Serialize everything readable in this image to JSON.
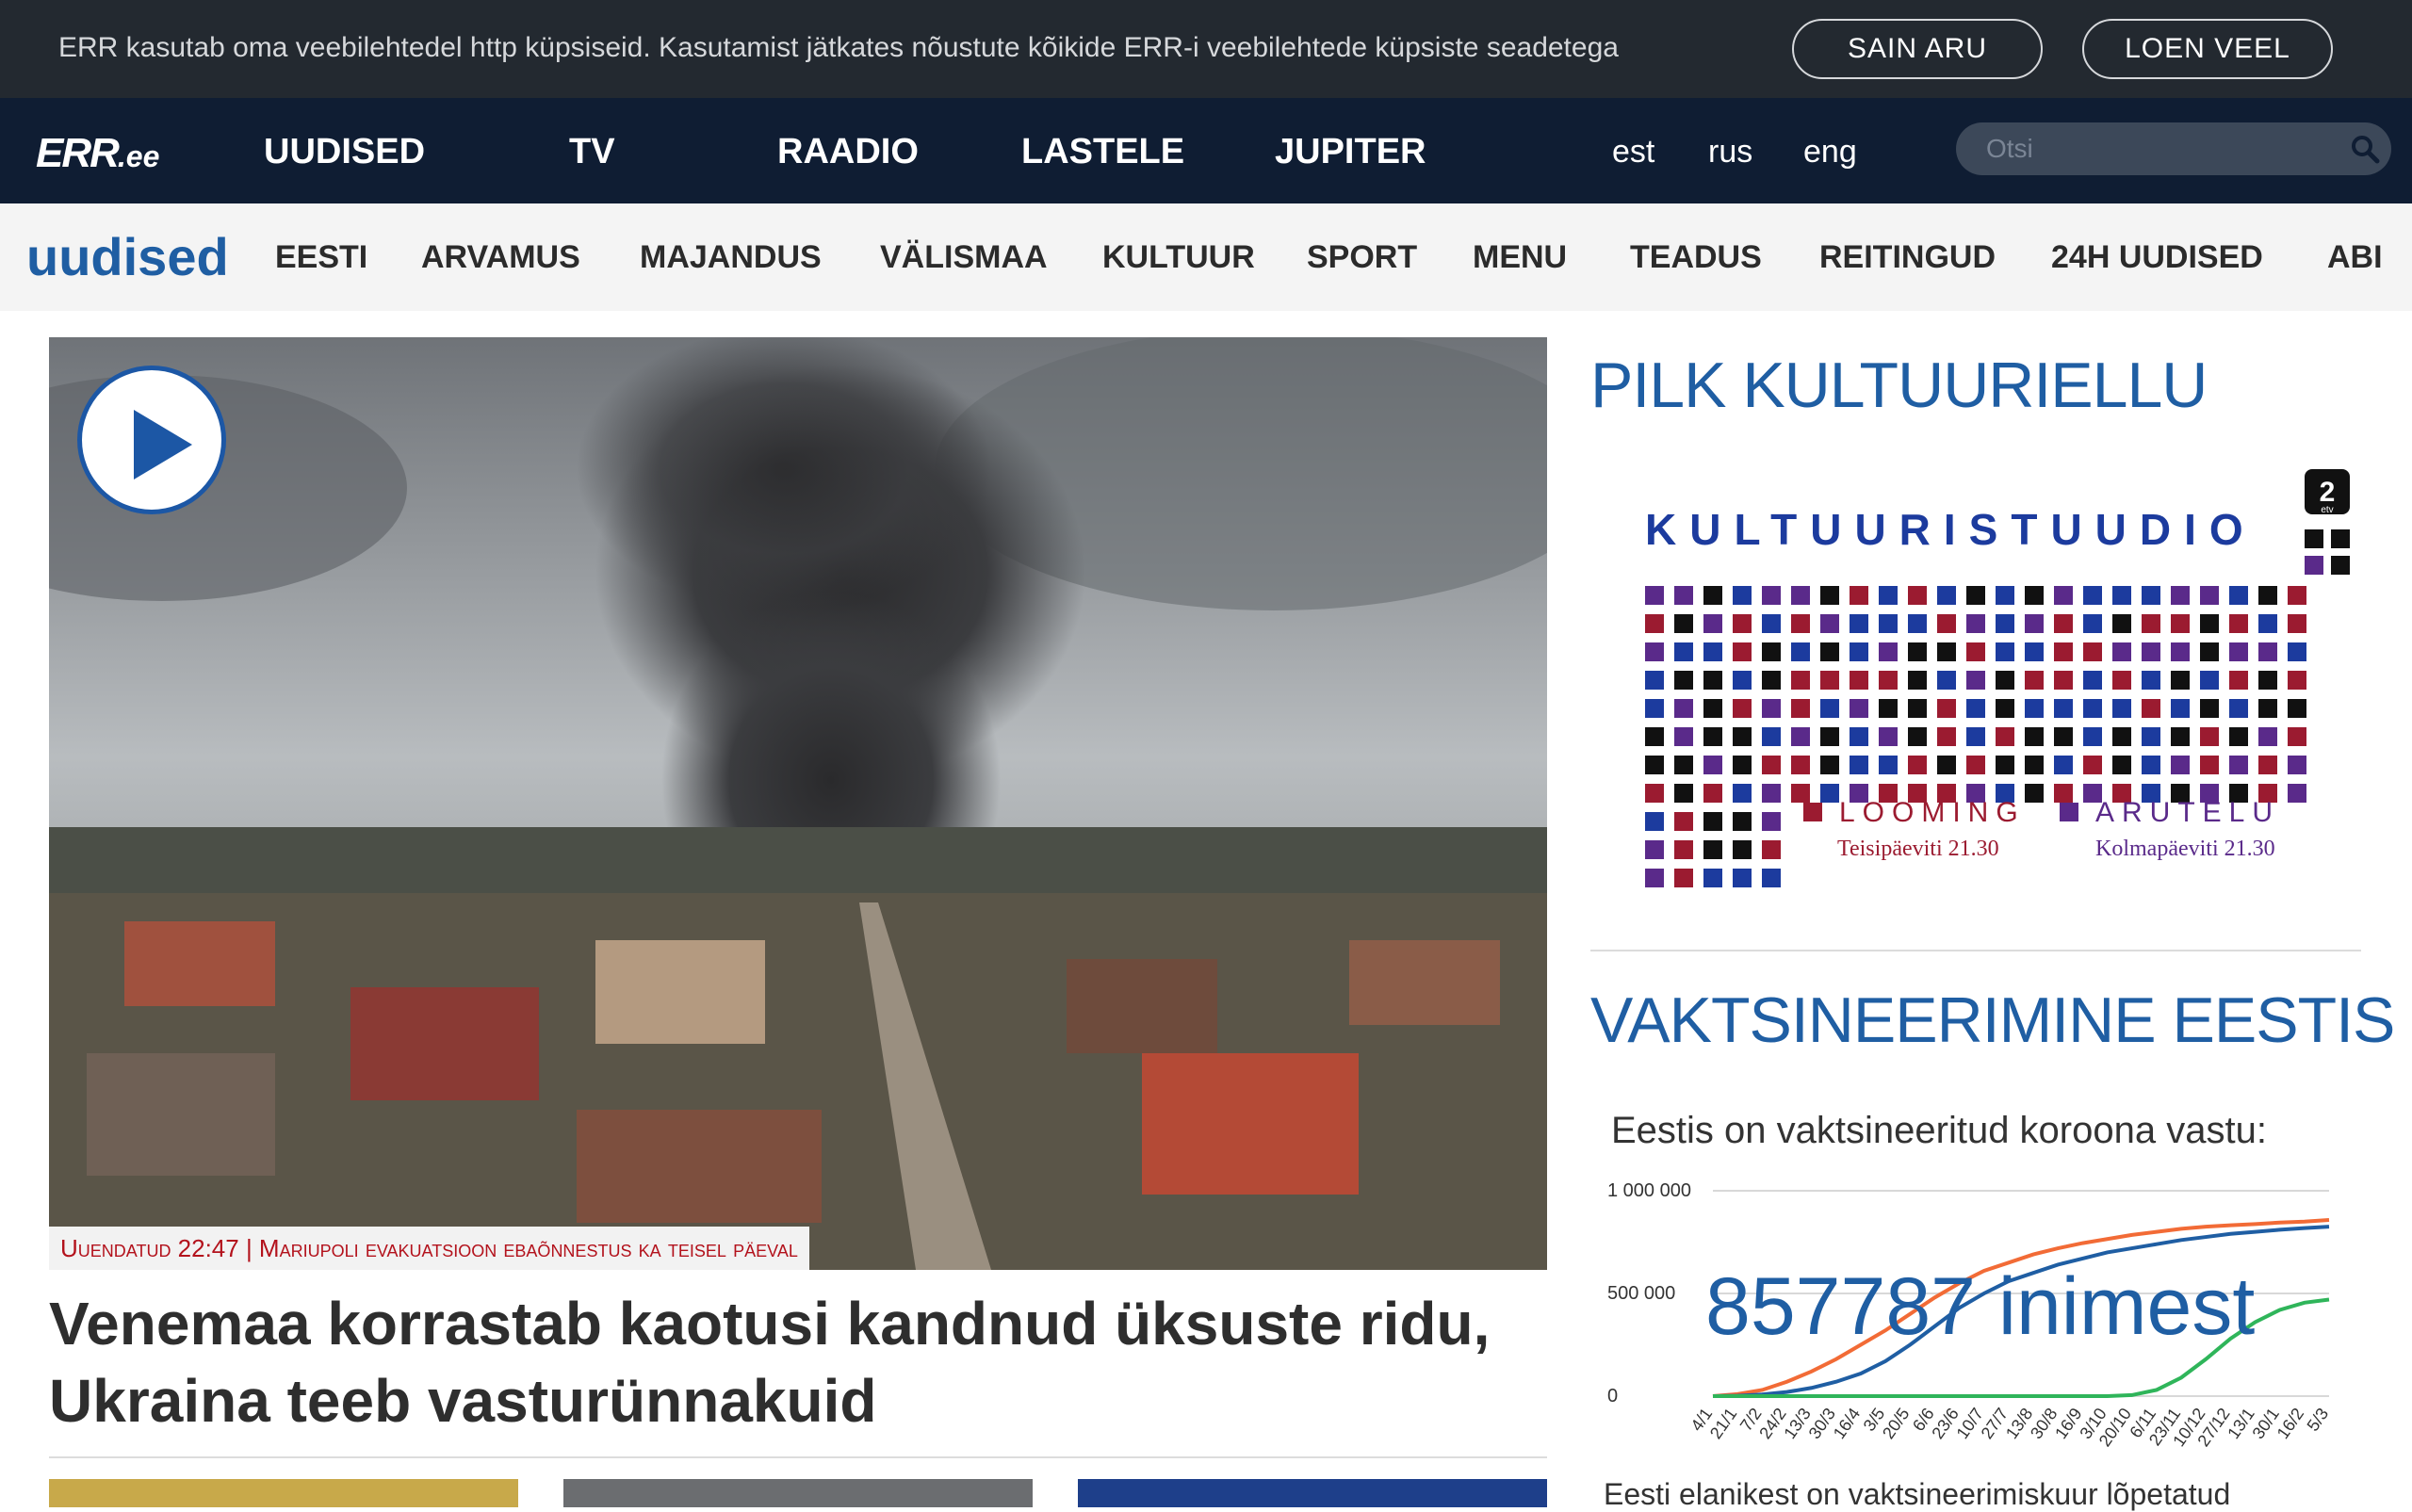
{
  "cookie": {
    "text": "ERR kasutab oma veebilehtedel http küpsiseid. Kasutamist jätkates nõustute kõikide ERR-i veebilehtede küpsiste seadetega",
    "accept_label": "SAIN ARU",
    "more_label": "LOEN VEEL"
  },
  "topnav": {
    "logo_main": "ERR",
    "logo_suffix": ".ee",
    "items": [
      "UUDISED",
      "TV",
      "RAADIO",
      "LASTELE",
      "JUPITER"
    ],
    "languages": [
      "est",
      "rus",
      "eng"
    ],
    "search_placeholder": "Otsi"
  },
  "subnav": {
    "logo": "uudised",
    "items": [
      "EESTI",
      "ARVAMUS",
      "MAJANDUS",
      "VÄLISMAA",
      "KULTUUR",
      "SPORT",
      "MENU",
      "TEADUS",
      "REITINGUD",
      "24H UUDISED",
      "ABI"
    ]
  },
  "main": {
    "caption": "Uuendatud 22:47 | Mariupoli evakuatsioon ebaõnnestus ka teisel päeval",
    "headline": "Venemaa korrastab kaotusi kandnud üksuste ridu, Ukraina teeb vasturünnakuid"
  },
  "sidebar": {
    "promo_title": "PILK KULTUURIELLU",
    "promo": {
      "channel_badge": "2",
      "channel_sub": "etv",
      "title": "KULTUURISTUUDIO",
      "show1_name": "LOOMING",
      "show1_time": "Teisipäeviti 21.30",
      "show2_name": "ARUTELU",
      "show2_time": "Kolmapäeviti 21.30"
    },
    "vacc_title": "VAKTSINEERIMINE EESTIS",
    "vacc_label": "Eestis on vaktsineeritud koroona vastu:",
    "vacc_count": "857787 inimest",
    "vacc_footer": "Eesti elanikest on vaktsineerimiskuur lõpetatud"
  },
  "chart_data": {
    "type": "line",
    "title": "",
    "ylabel": "",
    "yticks": [
      "1 000 000",
      "500 000",
      "0"
    ],
    "ylim": [
      0,
      1000000
    ],
    "categories": [
      "4/1",
      "21/1",
      "7/2",
      "24/2",
      "13/3",
      "30/3",
      "16/4",
      "3/5",
      "20/5",
      "6/6",
      "23/6",
      "10/7",
      "27/7",
      "13/8",
      "30/8",
      "16/9",
      "3/10",
      "20/10",
      "6/11",
      "23/11",
      "10/12",
      "27/12",
      "13/1",
      "30/1",
      "16/2",
      "5/3"
    ],
    "series": [
      {
        "color": "#f26b36",
        "values": [
          0,
          10000,
          30000,
          70000,
          120000,
          180000,
          250000,
          320000,
          400000,
          480000,
          550000,
          610000,
          650000,
          690000,
          720000,
          745000,
          765000,
          785000,
          800000,
          815000,
          825000,
          832000,
          838000,
          845000,
          850000,
          857787
        ]
      },
      {
        "color": "#1f5ea3",
        "values": [
          0,
          2000,
          8000,
          20000,
          40000,
          70000,
          110000,
          170000,
          250000,
          340000,
          430000,
          500000,
          560000,
          600000,
          640000,
          670000,
          700000,
          720000,
          740000,
          760000,
          775000,
          790000,
          800000,
          810000,
          818000,
          825000
        ]
      },
      {
        "color": "#2fb55a",
        "values": [
          0,
          0,
          0,
          0,
          0,
          0,
          0,
          0,
          0,
          0,
          0,
          0,
          0,
          0,
          0,
          0,
          0,
          5000,
          30000,
          90000,
          180000,
          280000,
          360000,
          420000,
          455000,
          470000
        ]
      }
    ]
  }
}
